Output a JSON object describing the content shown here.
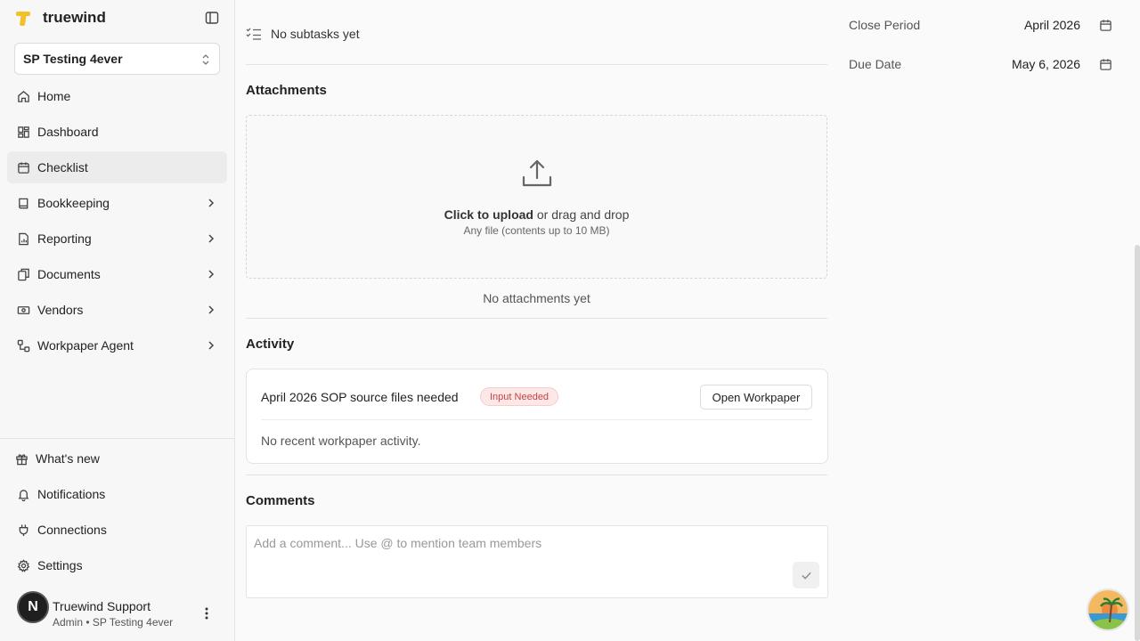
{
  "brand": {
    "name": "truewind"
  },
  "org_selector": {
    "value": "SP Testing 4ever"
  },
  "nav": [
    {
      "label": "Home",
      "icon": "home-icon",
      "expandable": false
    },
    {
      "label": "Dashboard",
      "icon": "dashboard-icon",
      "expandable": false
    },
    {
      "label": "Checklist",
      "icon": "calendar-icon",
      "expandable": false,
      "active": true
    },
    {
      "label": "Bookkeeping",
      "icon": "book-icon",
      "expandable": true
    },
    {
      "label": "Reporting",
      "icon": "file-chart-icon",
      "expandable": true
    },
    {
      "label": "Documents",
      "icon": "documents-icon",
      "expandable": true
    },
    {
      "label": "Vendors",
      "icon": "banknote-icon",
      "expandable": true
    },
    {
      "label": "Workpaper Agent",
      "icon": "workflow-icon",
      "expandable": true
    }
  ],
  "bottom_nav": [
    {
      "label": "What's new",
      "icon": "gift-icon"
    },
    {
      "label": "Notifications",
      "icon": "bell-icon"
    },
    {
      "label": "Connections",
      "icon": "plug-icon"
    },
    {
      "label": "Settings",
      "icon": "gear-icon"
    }
  ],
  "user": {
    "initial": "N",
    "name": "Truewind Support",
    "role": "Admin • SP Testing 4ever"
  },
  "subtasks": {
    "empty_text": "No subtasks yet"
  },
  "attachments": {
    "title": "Attachments",
    "upload_bold": "Click to upload",
    "upload_rest": " or drag and drop",
    "upload_hint": "Any file (contents up to 10 MB)",
    "empty_text": "No attachments yet"
  },
  "activity": {
    "title": "Activity",
    "item_title": "April 2026 SOP source files needed",
    "badge": "Input Needed",
    "open_button": "Open Workpaper",
    "empty_text": "No recent workpaper activity."
  },
  "comments": {
    "title": "Comments",
    "placeholder": "Add a comment... Use @ to mention team members"
  },
  "details": {
    "close_period_label": "Close Period",
    "close_period_value": "April 2026",
    "due_date_label": "Due Date",
    "due_date_value": "May 6, 2026"
  },
  "colors": {
    "brand": "#f2c028",
    "badge_bg": "#fde7e7",
    "badge_text": "#c24444"
  }
}
